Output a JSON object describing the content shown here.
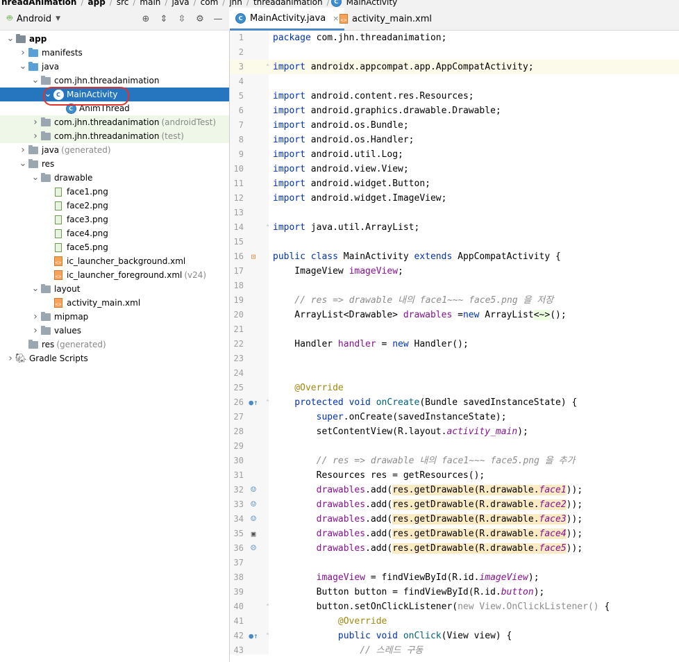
{
  "breadcrumb": [
    "hreadAnimation",
    "app",
    "src",
    "main",
    "java",
    "com",
    "jhn",
    "threadanimation",
    "MainActivity"
  ],
  "panel": {
    "view": "Android",
    "tools": [
      "locate-icon",
      "expand-all-icon",
      "collapse-all-icon",
      "gear-icon",
      "minimize-icon"
    ]
  },
  "tree": [
    {
      "label": "app",
      "suffix": "",
      "depth": 0,
      "arrow": "v",
      "icon": "module",
      "bold": true
    },
    {
      "label": "manifests",
      "suffix": "",
      "depth": 1,
      "arrow": ">",
      "icon": "folder-blue"
    },
    {
      "label": "java",
      "suffix": "",
      "depth": 1,
      "arrow": "v",
      "icon": "folder-blue"
    },
    {
      "label": "com.jhn.threadanimation",
      "suffix": "",
      "depth": 2,
      "arrow": "v",
      "icon": "folder"
    },
    {
      "label": "MainActivity",
      "suffix": "",
      "depth": 3,
      "arrow": "v",
      "icon": "class",
      "selected": true
    },
    {
      "label": "AnimThread",
      "suffix": "",
      "depth": 4,
      "arrow": "",
      "icon": "class"
    },
    {
      "label": "com.jhn.threadanimation",
      "suffix": "(androidTest)",
      "depth": 2,
      "arrow": ">",
      "icon": "folder",
      "green": true
    },
    {
      "label": "com.jhn.threadanimation",
      "suffix": "(test)",
      "depth": 2,
      "arrow": ">",
      "icon": "folder",
      "green": true
    },
    {
      "label": "java",
      "suffix": "(generated)",
      "depth": 1,
      "arrow": ">",
      "icon": "folder-gen"
    },
    {
      "label": "res",
      "suffix": "",
      "depth": 1,
      "arrow": "v",
      "icon": "folder-res"
    },
    {
      "label": "drawable",
      "suffix": "",
      "depth": 2,
      "arrow": "v",
      "icon": "folder"
    },
    {
      "label": "face1.png",
      "suffix": "",
      "depth": 3,
      "arrow": "",
      "icon": "image"
    },
    {
      "label": "face2.png",
      "suffix": "",
      "depth": 3,
      "arrow": "",
      "icon": "image"
    },
    {
      "label": "face3.png",
      "suffix": "",
      "depth": 3,
      "arrow": "",
      "icon": "image"
    },
    {
      "label": "face4.png",
      "suffix": "",
      "depth": 3,
      "arrow": "",
      "icon": "image"
    },
    {
      "label": "face5.png",
      "suffix": "",
      "depth": 3,
      "arrow": "",
      "icon": "image"
    },
    {
      "label": "ic_launcher_background.xml",
      "suffix": "",
      "depth": 3,
      "arrow": "",
      "icon": "xml"
    },
    {
      "label": "ic_launcher_foreground.xml",
      "suffix": "(v24)",
      "depth": 3,
      "arrow": "",
      "icon": "xml"
    },
    {
      "label": "layout",
      "suffix": "",
      "depth": 2,
      "arrow": "v",
      "icon": "folder"
    },
    {
      "label": "activity_main.xml",
      "suffix": "",
      "depth": 3,
      "arrow": "",
      "icon": "xml"
    },
    {
      "label": "mipmap",
      "suffix": "",
      "depth": 2,
      "arrow": ">",
      "icon": "folder"
    },
    {
      "label": "values",
      "suffix": "",
      "depth": 2,
      "arrow": ">",
      "icon": "folder"
    },
    {
      "label": "res",
      "suffix": "(generated)",
      "depth": 1,
      "arrow": "",
      "icon": "folder-res"
    },
    {
      "label": "Gradle Scripts",
      "suffix": "",
      "depth": 0,
      "arrow": ">",
      "icon": "gradle"
    }
  ],
  "tabs": [
    {
      "label": "MainActivity.java",
      "icon": "class-icon",
      "active": true,
      "closable": true
    },
    {
      "label": "activity_main.xml",
      "icon": "xml-file-icon",
      "active": false,
      "closable": false
    }
  ],
  "lines": [
    {
      "n": "1",
      "segs": [
        [
          "kw",
          "package "
        ],
        [
          "",
          "com.jhn.threadanimation;"
        ]
      ]
    },
    {
      "n": "2",
      "segs": []
    },
    {
      "n": "3",
      "hl": true,
      "fold": "⊖",
      "segs": [
        [
          "kw",
          "import "
        ],
        [
          "",
          "androidx.appcompat.app.AppCompatActivity;"
        ]
      ]
    },
    {
      "n": "4",
      "segs": []
    },
    {
      "n": "5",
      "segs": [
        [
          "kw",
          "import "
        ],
        [
          "",
          "android.content.res.Resources;"
        ]
      ]
    },
    {
      "n": "6",
      "segs": [
        [
          "kw",
          "import "
        ],
        [
          "",
          "android.graphics.drawable.Drawable;"
        ]
      ]
    },
    {
      "n": "7",
      "segs": [
        [
          "kw",
          "import "
        ],
        [
          "",
          "android.os.Bundle;"
        ]
      ]
    },
    {
      "n": "8",
      "segs": [
        [
          "kw",
          "import "
        ],
        [
          "",
          "android.os.Handler;"
        ]
      ]
    },
    {
      "n": "9",
      "segs": [
        [
          "kw",
          "import "
        ],
        [
          "",
          "android.util.Log;"
        ]
      ]
    },
    {
      "n": "10",
      "segs": [
        [
          "kw",
          "import "
        ],
        [
          "",
          "android.view.View;"
        ]
      ]
    },
    {
      "n": "11",
      "segs": [
        [
          "kw",
          "import "
        ],
        [
          "",
          "android.widget.Button;"
        ]
      ]
    },
    {
      "n": "12",
      "segs": [
        [
          "kw",
          "import "
        ],
        [
          "",
          "android.widget.ImageView;"
        ]
      ]
    },
    {
      "n": "13",
      "segs": []
    },
    {
      "n": "14",
      "fold": "⊖",
      "segs": [
        [
          "kw",
          "import "
        ],
        [
          "",
          "java.util.ArrayList;"
        ]
      ]
    },
    {
      "n": "15",
      "segs": []
    },
    {
      "n": "16",
      "mark": "xml",
      "segs": [
        [
          "kw",
          "public class "
        ],
        [
          "",
          "MainActivity "
        ],
        [
          "kw",
          "extends "
        ],
        [
          "",
          "AppCompatActivity {"
        ]
      ]
    },
    {
      "n": "17",
      "segs": [
        [
          "",
          "    ImageView "
        ],
        [
          "fld",
          "imageView"
        ],
        [
          "",
          ";"
        ]
      ]
    },
    {
      "n": "18",
      "segs": []
    },
    {
      "n": "19",
      "segs": [
        [
          "cmt",
          "    // res => drawable 내의 face1~~~ face5.png 을 저장"
        ]
      ]
    },
    {
      "n": "20",
      "segs": [
        [
          "",
          "    ArrayList<Drawable> "
        ],
        [
          "fld",
          "drawables "
        ],
        [
          "",
          "="
        ],
        [
          "kw",
          "new "
        ],
        [
          "",
          "ArrayList"
        ],
        [
          "hl-diam",
          "<~>"
        ],
        [
          "",
          "();"
        ]
      ]
    },
    {
      "n": "21",
      "segs": []
    },
    {
      "n": "22",
      "segs": [
        [
          "",
          "    Handler "
        ],
        [
          "fld",
          "handler "
        ],
        [
          "",
          "= "
        ],
        [
          "kw",
          "new "
        ],
        [
          "",
          "Handler();"
        ]
      ]
    },
    {
      "n": "23",
      "segs": []
    },
    {
      "n": "24",
      "segs": []
    },
    {
      "n": "25",
      "segs": [
        [
          "ann",
          "    @Override"
        ]
      ]
    },
    {
      "n": "26",
      "mark": "override",
      "fold": "⊖",
      "segs": [
        [
          "kw",
          "    protected void "
        ],
        [
          "fn",
          "onCreate"
        ],
        [
          "",
          "(Bundle savedInstanceState) {"
        ]
      ]
    },
    {
      "n": "27",
      "segs": [
        [
          "kw",
          "        super"
        ],
        [
          "",
          ".onCreate(savedInstanceState);"
        ]
      ]
    },
    {
      "n": "28",
      "segs": [
        [
          "",
          "        setContentView(R.layout."
        ],
        [
          "fld it",
          "activity_main"
        ],
        [
          "",
          ");"
        ]
      ]
    },
    {
      "n": "29",
      "segs": []
    },
    {
      "n": "30",
      "segs": [
        [
          "cmt",
          "        // res => drawable 내의 face1~~~ face5.png 을 추가"
        ]
      ]
    },
    {
      "n": "31",
      "segs": [
        [
          "",
          "        Resources res = getResources();"
        ]
      ]
    },
    {
      "n": "32",
      "mark": "smiley",
      "segs": [
        [
          "fld",
          "        drawables"
        ],
        [
          "",
          ".add("
        ],
        [
          "hl-arg",
          "res.getDrawable(R.drawable."
        ],
        [
          "hl-arg fld it",
          "face1"
        ],
        [
          "",
          ")"
        ],
        [
          "",
          ");"
        ]
      ]
    },
    {
      "n": "33",
      "mark": "smiley",
      "segs": [
        [
          "fld",
          "        drawables"
        ],
        [
          "",
          ".add("
        ],
        [
          "hl-arg",
          "res.getDrawable(R.drawable."
        ],
        [
          "hl-arg fld it",
          "face2"
        ],
        [
          "",
          ")"
        ],
        [
          "",
          ");"
        ]
      ]
    },
    {
      "n": "34",
      "mark": "smiley",
      "segs": [
        [
          "fld",
          "        drawables"
        ],
        [
          "",
          ".add("
        ],
        [
          "hl-arg",
          "res.getDrawable(R.drawable."
        ],
        [
          "hl-arg fld it",
          "face3"
        ],
        [
          "",
          ")"
        ],
        [
          "",
          ");"
        ]
      ]
    },
    {
      "n": "35",
      "mark": "image",
      "segs": [
        [
          "fld",
          "        drawables"
        ],
        [
          "",
          ".add("
        ],
        [
          "hl-arg",
          "res.getDrawable(R.drawable."
        ],
        [
          "hl-arg fld it",
          "face4"
        ],
        [
          "",
          ")"
        ],
        [
          "",
          ");"
        ]
      ]
    },
    {
      "n": "36",
      "mark": "sad",
      "segs": [
        [
          "fld",
          "        drawables"
        ],
        [
          "",
          ".add("
        ],
        [
          "hl-arg",
          "res.getDrawable(R.drawable."
        ],
        [
          "hl-arg fld it",
          "face5"
        ],
        [
          "",
          ")"
        ],
        [
          "",
          ");"
        ]
      ]
    },
    {
      "n": "37",
      "segs": []
    },
    {
      "n": "38",
      "segs": [
        [
          "fld",
          "        imageView "
        ],
        [
          "",
          "= findViewById(R.id."
        ],
        [
          "fld it",
          "imageView"
        ],
        [
          "",
          ");"
        ]
      ]
    },
    {
      "n": "39",
      "segs": [
        [
          "",
          "        Button button = findViewById(R.id."
        ],
        [
          "fld it",
          "button"
        ],
        [
          "",
          ");"
        ]
      ]
    },
    {
      "n": "40",
      "fold": "⊖",
      "segs": [
        [
          "",
          "        button.setOnClickListener("
        ],
        [
          "gray-code",
          "new View.OnClickListener() "
        ],
        [
          "",
          "{"
        ]
      ]
    },
    {
      "n": "41",
      "segs": [
        [
          "ann",
          "            @Override"
        ]
      ]
    },
    {
      "n": "42",
      "mark": "override",
      "fold": "⊖",
      "segs": [
        [
          "kw",
          "            public void "
        ],
        [
          "fn",
          "onClick"
        ],
        [
          "",
          "(View view) {"
        ]
      ]
    },
    {
      "n": "43",
      "segs": [
        [
          "cmt",
          "                // 스레드 구동"
        ]
      ]
    }
  ]
}
